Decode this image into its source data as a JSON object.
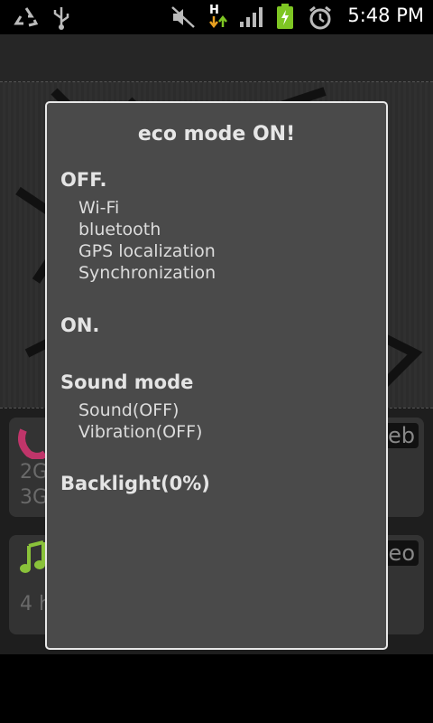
{
  "status_bar": {
    "time": "5:48 PM",
    "icons": [
      "recycle-icon",
      "usb-icon",
      "mute-icon",
      "data-transfer-icon",
      "signal-icon",
      "battery-charging-icon",
      "alarm-icon"
    ],
    "network_letter": "H"
  },
  "background": {
    "card1_lines": [
      "2G",
      "3G"
    ],
    "card1_tag": "eb",
    "card2_lines": [
      "4 h"
    ],
    "card2_tag": "eo"
  },
  "dialog": {
    "title": "eco mode ON!",
    "off_heading": "OFF.",
    "off_items": [
      "Wi-Fi",
      "bluetooth",
      "GPS localization",
      "Synchronization"
    ],
    "on_heading": "ON.",
    "sound_heading": "Sound mode",
    "sound_items": [
      "Sound(OFF)",
      "Vibration(OFF)"
    ],
    "backlight_heading": "Backlight(0%)"
  },
  "colors": {
    "dialog_bg": "#4a4a4a",
    "dialog_border": "#e8e8e8",
    "battery_green": "#7ec623"
  }
}
